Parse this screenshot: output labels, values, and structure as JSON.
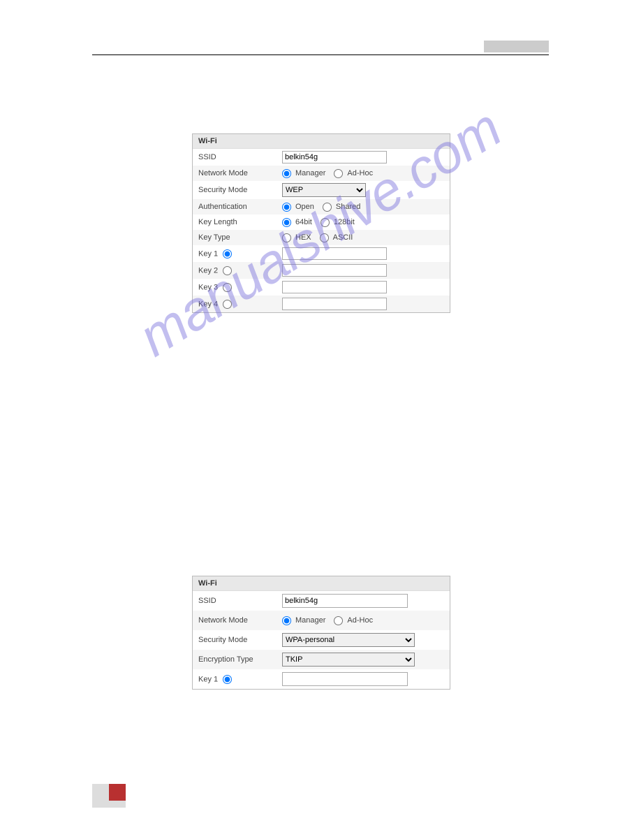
{
  "watermark": "manualshive.com",
  "panel1": {
    "title": "Wi-Fi",
    "ssid_label": "SSID",
    "ssid_value": "belkin54g",
    "network_mode_label": "Network Mode",
    "network_mode_manager": "Manager",
    "network_mode_adhoc": "Ad-Hoc",
    "security_mode_label": "Security Mode",
    "security_mode_value": "WEP",
    "auth_label": "Authentication",
    "auth_open": "Open",
    "auth_shared": "Shared",
    "key_length_label": "Key Length",
    "key_length_64": "64bit",
    "key_length_128": "128bit",
    "key_type_label": "Key Type",
    "key_type_hex": "HEX",
    "key_type_ascii": "ASCII",
    "key1_label": "Key 1",
    "key2_label": "Key 2",
    "key3_label": "Key 3",
    "key4_label": "Key 4"
  },
  "panel2": {
    "title": "Wi-Fi",
    "ssid_label": "SSID",
    "ssid_value": "belkin54g",
    "network_mode_label": "Network Mode",
    "network_mode_manager": "Manager",
    "network_mode_adhoc": "Ad-Hoc",
    "security_mode_label": "Security Mode",
    "security_mode_value": "WPA-personal",
    "encryption_type_label": "Encryption Type",
    "encryption_type_value": "TKIP",
    "key1_label": "Key 1"
  }
}
